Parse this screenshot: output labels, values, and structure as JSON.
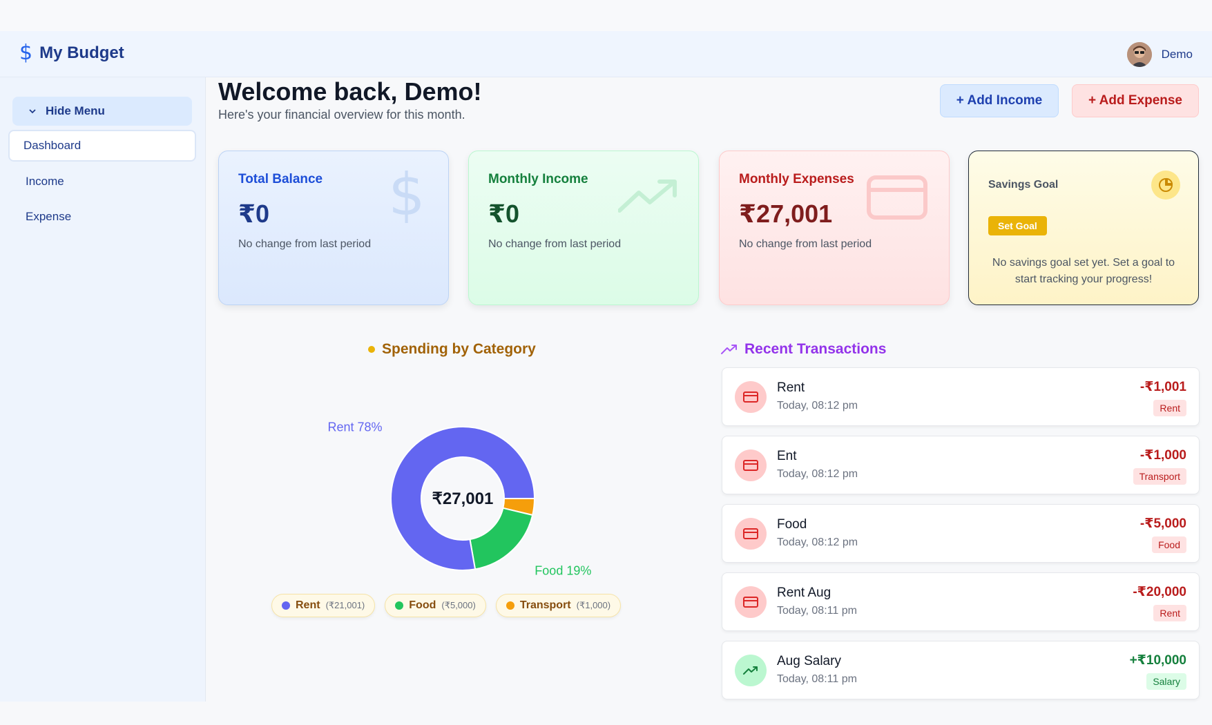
{
  "app": {
    "title": "My Budget",
    "username": "Demo"
  },
  "sidebar": {
    "hide_menu": "Hide Menu",
    "items": [
      {
        "label": "Dashboard",
        "active": true
      },
      {
        "label": "Income",
        "active": false
      },
      {
        "label": "Expense",
        "active": false
      }
    ]
  },
  "header": {
    "welcome": "Welcome back, Demo!",
    "subtitle": "Here's your financial overview for this month.",
    "add_income": "+ Add Income",
    "add_expense": "+ Add Expense"
  },
  "cards": {
    "balance": {
      "title": "Total Balance",
      "value": "₹0",
      "note": "No change from last period"
    },
    "income": {
      "title": "Monthly Income",
      "value": "₹0",
      "note": "No change from last period"
    },
    "expense": {
      "title": "Monthly Expenses",
      "value": "₹27,001",
      "note": "No change from last period"
    },
    "goal": {
      "title": "Savings Goal",
      "button": "Set Goal",
      "text": "No savings goal set yet. Set a goal to start tracking your progress!"
    }
  },
  "spending": {
    "title": "Spending by Category",
    "center_total": "₹27,001",
    "legend": [
      {
        "name": "Rent",
        "amount": "(₹21,001)",
        "color": "#6366f1"
      },
      {
        "name": "Food",
        "amount": "(₹5,000)",
        "color": "#22c55e"
      },
      {
        "name": "Transport",
        "amount": "(₹1,000)",
        "color": "#f59e0b"
      }
    ]
  },
  "chart_data": {
    "type": "pie",
    "categories": [
      "Rent",
      "Food",
      "Transport"
    ],
    "values": [
      21001,
      5000,
      1000
    ],
    "colors": [
      "#6366f1",
      "#22c55e",
      "#f59e0b"
    ],
    "slice_labels": [
      "Rent 78%",
      "Food 19%",
      ""
    ],
    "title": "Spending by Category",
    "center_label": "₹27,001"
  },
  "recent": {
    "title": "Recent Transactions",
    "items": [
      {
        "name": "Rent",
        "time": "Today, 08:12 pm",
        "amount": "-₹1,001",
        "tag": "Rent",
        "kind": "expense"
      },
      {
        "name": "Ent",
        "time": "Today, 08:12 pm",
        "amount": "-₹1,000",
        "tag": "Transport",
        "kind": "expense"
      },
      {
        "name": "Food",
        "time": "Today, 08:12 pm",
        "amount": "-₹5,000",
        "tag": "Food",
        "kind": "expense"
      },
      {
        "name": "Rent Aug",
        "time": "Today, 08:11 pm",
        "amount": "-₹20,000",
        "tag": "Rent",
        "kind": "expense"
      },
      {
        "name": "Aug Salary",
        "time": "Today, 08:11 pm",
        "amount": "+₹10,000",
        "tag": "Salary",
        "kind": "income"
      }
    ]
  }
}
